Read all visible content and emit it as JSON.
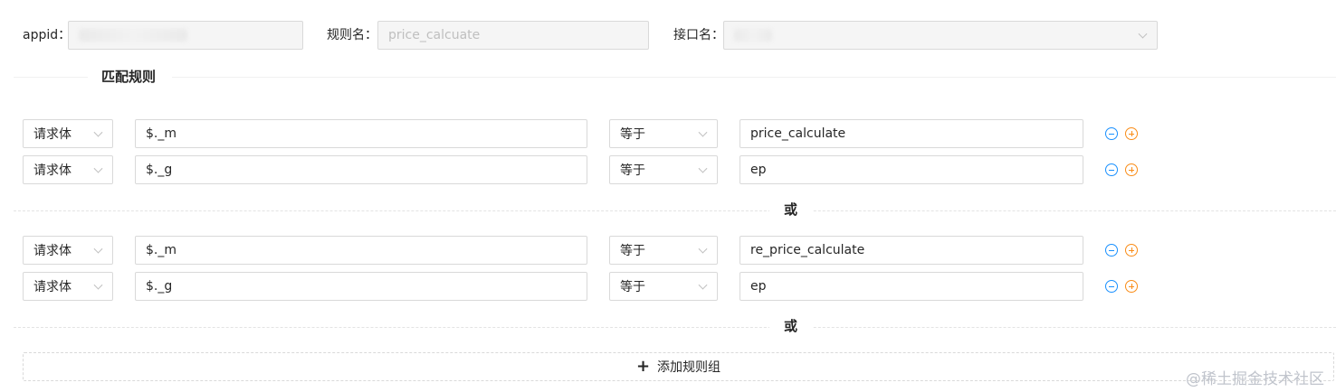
{
  "header": {
    "appid_label": "appid：",
    "rule_name_label": "规则名：",
    "rule_name_placeholder": "price_calcuate",
    "api_name_label": "接口名："
  },
  "section": {
    "title": "匹配规则",
    "or_label": "或"
  },
  "groups": [
    {
      "rows": [
        {
          "source": "请求体",
          "path": "$._m",
          "op": "等于",
          "value": "price_calculate"
        },
        {
          "source": "请求体",
          "path": "$._g",
          "op": "等于",
          "value": "ep"
        }
      ]
    },
    {
      "rows": [
        {
          "source": "请求体",
          "path": "$._m",
          "op": "等于",
          "value": "re_price_calculate"
        },
        {
          "source": "请求体",
          "path": "$._g",
          "op": "等于",
          "value": "ep"
        }
      ]
    }
  ],
  "add_group": {
    "label": "添加规则组",
    "icon": "plus-icon"
  },
  "watermark": "@稀土掘金技术社区",
  "colors": {
    "minus": "#1890ff",
    "plus": "#fa8c16",
    "border": "#d9d9d9",
    "disabled_bg": "#f5f5f5"
  }
}
